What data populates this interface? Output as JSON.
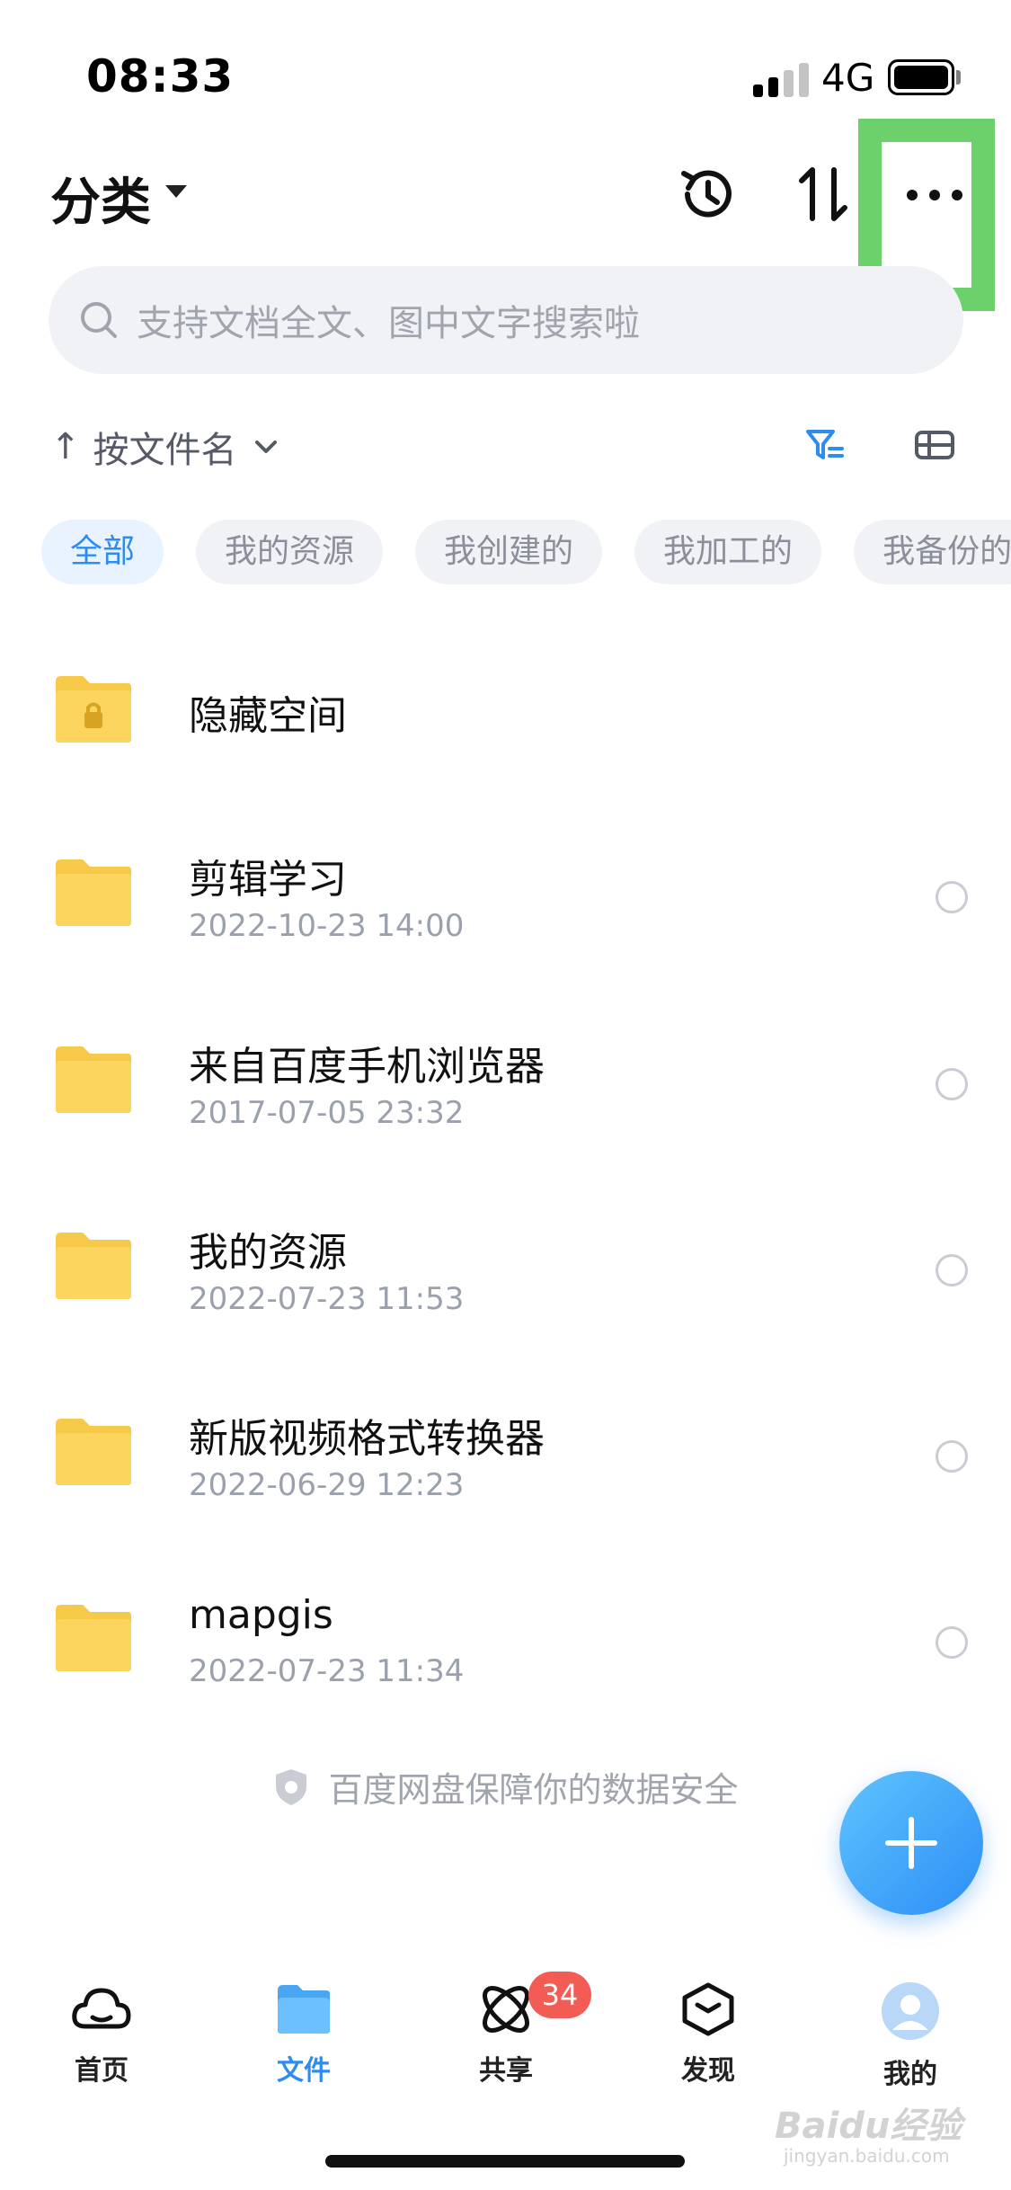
{
  "status_bar": {
    "time": "08:33",
    "network": "4G"
  },
  "header": {
    "title": "分类",
    "icons": [
      "history-icon",
      "sort-icon",
      "more-icon"
    ]
  },
  "search": {
    "placeholder": "支持文档全文、图中文字搜索啦"
  },
  "sort": {
    "label": "按文件名",
    "icons": [
      "filter-icon",
      "view-toggle-icon"
    ]
  },
  "chips": [
    "全部",
    "我的资源",
    "我创建的",
    "我加工的",
    "我备份的"
  ],
  "files": [
    {
      "name": "隐藏空间",
      "date": ""
    },
    {
      "name": "剪辑学习",
      "date": "2022-10-23 14:00"
    },
    {
      "name": "来自百度手机浏览器",
      "date": "2017-07-05 23:32"
    },
    {
      "name": "我的资源",
      "date": "2022-07-23 11:53"
    },
    {
      "name": "新版视频格式转换器",
      "date": "2022-06-29 12:23"
    },
    {
      "name": "mapgis",
      "date": "2022-07-23 11:34"
    }
  ],
  "footer_note": "百度网盘保障你的数据安全",
  "tabs": [
    {
      "label": "首页",
      "icon": "cloud-icon"
    },
    {
      "label": "文件",
      "icon": "folder-icon",
      "active": true
    },
    {
      "label": "共享",
      "icon": "share-icon",
      "badge": "34"
    },
    {
      "label": "发现",
      "icon": "discover-icon"
    },
    {
      "label": "我的",
      "icon": "avatar-icon"
    }
  ],
  "watermark": {
    "brand": "Baidu经验",
    "url": "jingyan.baidu.com"
  },
  "colors": {
    "accent": "#2e8cf0",
    "folder": "#fbd55e",
    "highlight": "#6cd06b",
    "badge": "#f25c54"
  }
}
